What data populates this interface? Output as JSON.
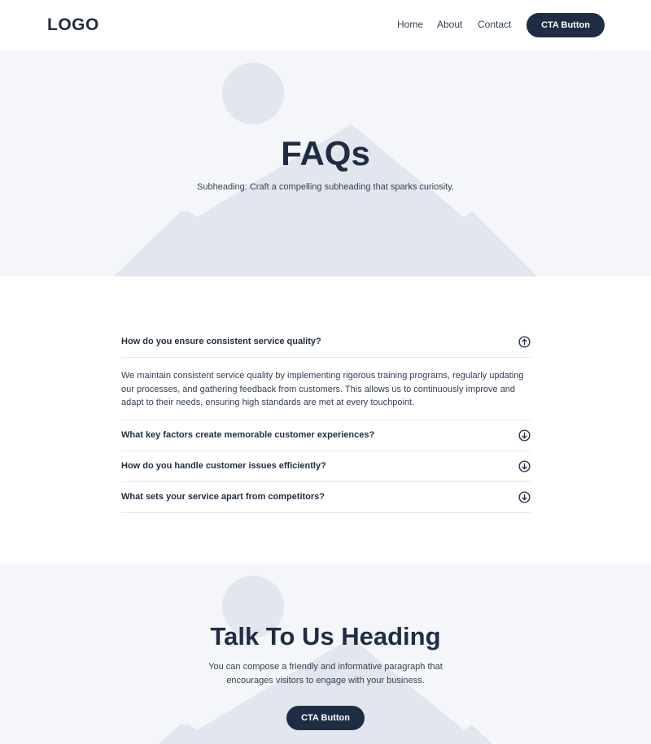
{
  "header": {
    "logo": "LOGO",
    "nav": [
      "Home",
      "About",
      "Contact"
    ],
    "cta_label": "CTA Button"
  },
  "hero": {
    "title": "FAQs",
    "subtitle": "Subheading: Craft a compelling subheading that sparks curiosity."
  },
  "faq": {
    "items": [
      {
        "question": "How do you ensure consistent service quality?",
        "expanded": true,
        "answer": "We maintain consistent service quality by implementing rigorous training programs, regularly updating our processes, and gathering feedback from customers. This allows us to continuously improve and adapt to their needs, ensuring high standards are met at every touchpoint."
      },
      {
        "question": "What key factors create memorable customer experiences?",
        "expanded": false
      },
      {
        "question": "How do you handle customer issues efficiently?",
        "expanded": false
      },
      {
        "question": "What sets your service apart from competitors?",
        "expanded": false
      }
    ]
  },
  "contact": {
    "title": "Talk To Us Heading",
    "text": "You can compose a friendly and informative paragraph that encourages visitors to engage with your business.",
    "cta_label": "CTA Button"
  },
  "colors": {
    "primary": "#1f2d44",
    "section_bg": "#f4f6f9",
    "placeholder_shape": "#e2e6ee",
    "divider": "#e5e8ee"
  },
  "icons": {
    "expanded": "arrow-up-circle-icon",
    "collapsed": "arrow-down-circle-icon",
    "placeholder": "image-placeholder-icon"
  }
}
